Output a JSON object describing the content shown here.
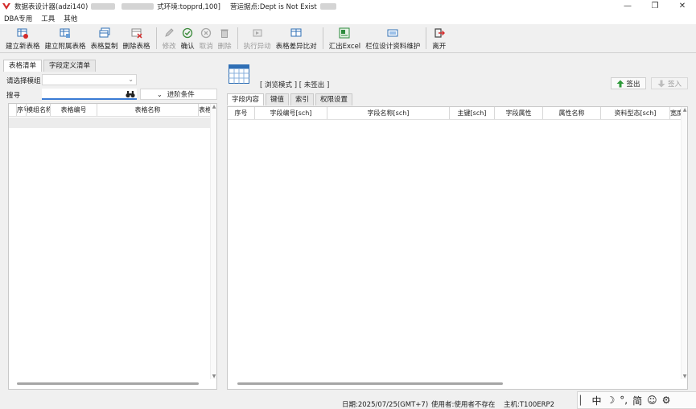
{
  "window": {
    "title": "数据表设计器(adzi140)",
    "env_label": "式环境:topprd,100]",
    "site_label": "营运据点:Dept is Not Exist",
    "controls": {
      "minimize": "—",
      "restore": "❐",
      "close": "✕"
    }
  },
  "menu": [
    "DBA专用",
    "工具",
    "其他"
  ],
  "toolbar": [
    {
      "label": "建立新表格",
      "icon": "new-table-icon",
      "enabled": true
    },
    {
      "label": "建立附属表格",
      "icon": "attach-table-icon",
      "enabled": true
    },
    {
      "label": "表格复制",
      "icon": "copy-table-icon",
      "enabled": true
    },
    {
      "label": "删除表格",
      "icon": "delete-table-icon",
      "enabled": true
    },
    {
      "label": "修改",
      "icon": "pencil-icon",
      "enabled": false
    },
    {
      "label": "确认",
      "icon": "check-circle-icon",
      "enabled": true
    },
    {
      "label": "取消",
      "icon": "cancel-circle-icon",
      "enabled": false
    },
    {
      "label": "删除",
      "icon": "trash-icon",
      "enabled": false
    },
    {
      "label": "执行异动",
      "icon": "execute-icon",
      "enabled": false
    },
    {
      "label": "表格差异比对",
      "icon": "compare-icon",
      "enabled": true
    },
    {
      "label": "汇出Excel",
      "icon": "excel-icon",
      "enabled": true
    },
    {
      "label": "栏位设计资料维护",
      "icon": "field-design-icon",
      "enabled": true
    },
    {
      "label": "离开",
      "icon": "exit-icon",
      "enabled": true
    }
  ],
  "left": {
    "tabs": [
      "表格清单",
      "字段定义清单"
    ],
    "module_label": "请选择模组",
    "module_value": "",
    "search_label": "搜寻",
    "search_value": "",
    "advanced_label": "进阶条件",
    "columns": [
      "序号",
      "模组名称",
      "表格编号",
      "表格名称",
      "表格"
    ]
  },
  "right": {
    "mode_text": "[ 浏览模式 ] [ 未签出 ]",
    "checkout_label": "签出",
    "checkin_label": "签入",
    "tabs": [
      "字段内容",
      "键值",
      "索引",
      "权限设置"
    ],
    "columns": [
      "序号",
      "字段编号[sch]",
      "字段名称[sch]",
      "主键[sch]",
      "字段属性",
      "属性名称",
      "资料型态[sch]",
      "宽度"
    ]
  },
  "status": {
    "date": "日期:2025/07/25(GMT+7)",
    "user": "使用者:使用者不存在",
    "host": "主机:T100ERP2"
  },
  "ime": [
    "中",
    "☽",
    "°,",
    "简",
    "☺",
    "⚙"
  ],
  "colors": {
    "accent": "#3a7bd5",
    "brand_red": "#d42b2b",
    "excel_green": "#2e8b3e",
    "checkout_green": "#2e9a3a"
  }
}
